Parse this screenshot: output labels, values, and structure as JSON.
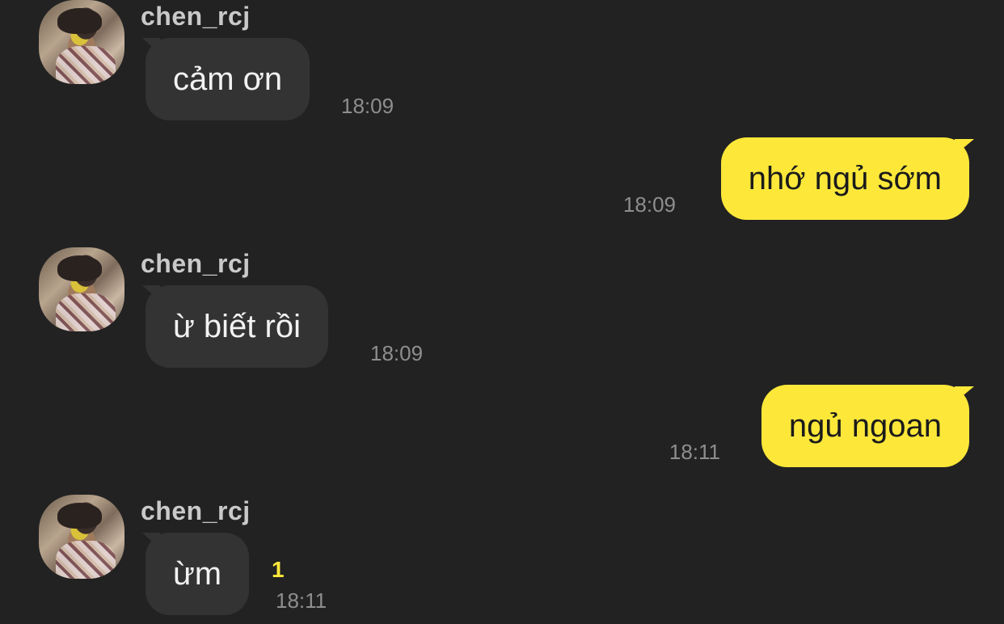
{
  "messages": [
    {
      "direction": "in",
      "sender": "chen_rcj",
      "text": "cảm ơn",
      "time": "18:09"
    },
    {
      "direction": "out",
      "text": "nhớ ngủ sớm",
      "time": "18:09"
    },
    {
      "direction": "in",
      "sender": "chen_rcj",
      "text": "ừ biết rồi",
      "time": "18:09"
    },
    {
      "direction": "out",
      "text": "ngủ ngoan",
      "time": "18:11"
    },
    {
      "direction": "in",
      "sender": "chen_rcj",
      "text": "ừm",
      "time": "18:11",
      "unread_count": "1"
    }
  ],
  "colors": {
    "background": "#222222",
    "incoming_bubble": "#333333",
    "outgoing_bubble": "#fde83a",
    "unread_accent": "#fde83a"
  },
  "icons": {
    "avatar": "user-avatar-photo"
  }
}
